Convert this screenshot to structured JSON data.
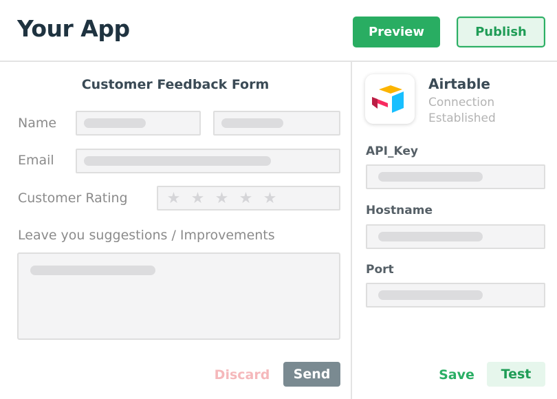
{
  "header": {
    "app_title": "Your App",
    "preview_label": "Preview",
    "publish_label": "Publish"
  },
  "form": {
    "title": "Customer Feedback Form",
    "name_label": "Name",
    "email_label": "Email",
    "rating_label": "Customer Rating",
    "rating_stars": 5,
    "rating_glyph": "★",
    "suggestions_label": "Leave you suggestions / Improvements",
    "discard_label": "Discard",
    "send_label": "Send"
  },
  "integration": {
    "name": "Airtable",
    "status": "Connection Established",
    "fields": [
      {
        "label": "API_Key"
      },
      {
        "label": "Hostname"
      },
      {
        "label": "Port"
      }
    ],
    "save_label": "Save",
    "test_label": "Test"
  },
  "colors": {
    "primary_green": "#29ad62",
    "dark_title": "#1f3340",
    "send_gray": "#7a8a91",
    "discard_pink": "#f5b8bb",
    "logo_yellow": "#fcb400",
    "logo_blue": "#18bfff",
    "logo_red": "#f82b60"
  }
}
